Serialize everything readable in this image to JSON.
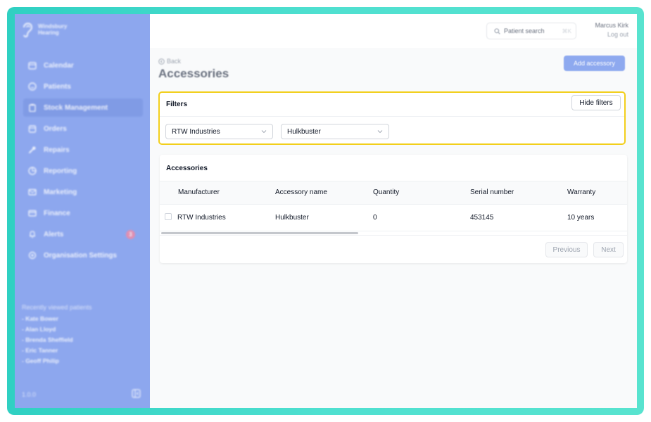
{
  "app": {
    "brand_line1": "Windsbury",
    "brand_line2": "Hearing"
  },
  "sidebar": {
    "items": [
      {
        "label": "Calendar",
        "icon": "calendar-icon"
      },
      {
        "label": "Patients",
        "icon": "smile-icon"
      },
      {
        "label": "Stock Management",
        "icon": "clipboard-icon",
        "active": true
      },
      {
        "label": "Orders",
        "icon": "box-icon"
      },
      {
        "label": "Repairs",
        "icon": "wrench-icon"
      },
      {
        "label": "Reporting",
        "icon": "pie-chart-icon"
      },
      {
        "label": "Marketing",
        "icon": "mail-icon"
      },
      {
        "label": "Finance",
        "icon": "card-icon"
      },
      {
        "label": "Alerts",
        "icon": "bell-icon",
        "badge": "3"
      },
      {
        "label": "Organisation Settings",
        "icon": "gear-icon"
      }
    ],
    "recent_title": "Recently viewed patients",
    "recent": [
      "- Kate Bower",
      "- Alan Lloyd",
      "- Brenda Sheffield",
      "- Eric Tanner",
      "- Geoff Philip"
    ],
    "version": "1.0.0"
  },
  "topbar": {
    "search_placeholder": "Patient search",
    "search_shortcut": "⌘K",
    "user_name": "Marcus Kirk",
    "logout": "Log out"
  },
  "page": {
    "back": "Back",
    "title": "Accessories",
    "add_button": "Add accessory"
  },
  "filters": {
    "title": "Filters",
    "hide_button": "Hide filters",
    "manufacturer_value": "RTW Industries",
    "accessory_value": "Hulkbuster"
  },
  "table": {
    "title": "Accessories",
    "columns": [
      "Manufacturer",
      "Accessory name",
      "Quantity",
      "Serial number",
      "Warranty"
    ],
    "rows": [
      [
        "RTW Industries",
        "Hulkbuster",
        "0",
        "453145",
        "10 years"
      ]
    ],
    "prev": "Previous",
    "next": "Next"
  },
  "colors": {
    "sidebar": "#8da7ee",
    "accent": "#8ea9ef",
    "highlight": "#f2cf1b",
    "frame": "#3dd6c8"
  }
}
